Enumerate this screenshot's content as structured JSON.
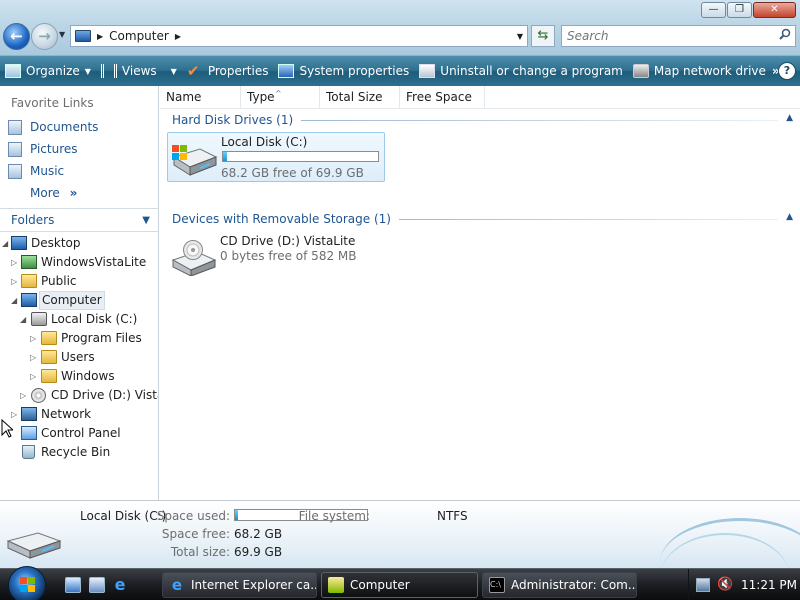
{
  "window": {
    "min_glyph": "—",
    "max_glyph": "❐",
    "close_glyph": "✕"
  },
  "nav": {
    "back_glyph": "←",
    "forward_glyph": "→"
  },
  "address": {
    "crumb": "Computer",
    "refresh_glyph": "⇆"
  },
  "search": {
    "placeholder": "Search"
  },
  "toolbar": {
    "organize": "Organize",
    "views": "Views",
    "properties": "Properties",
    "system_properties": "System properties",
    "uninstall": "Uninstall or change a program",
    "map_drive": "Map network drive",
    "more": "»",
    "help": "?"
  },
  "favorites": {
    "title": "Favorite Links",
    "items": [
      "Documents",
      "Pictures",
      "Music"
    ],
    "more": "More",
    "more_glyph": "»"
  },
  "folders": {
    "title": "Folders",
    "tree": [
      {
        "label": "Desktop"
      },
      {
        "label": "WindowsVistaLite"
      },
      {
        "label": "Public"
      },
      {
        "label": "Computer"
      },
      {
        "label": "Local Disk (C:)"
      },
      {
        "label": "Program Files"
      },
      {
        "label": "Users"
      },
      {
        "label": "Windows"
      },
      {
        "label": "CD Drive (D:) VistaLite"
      },
      {
        "label": "Network"
      },
      {
        "label": "Control Panel"
      },
      {
        "label": "Recycle Bin"
      }
    ]
  },
  "columns": [
    "Name",
    "Type",
    "Total Size",
    "Free Space"
  ],
  "groups": {
    "hard_disk": {
      "title": "Hard Disk Drives (1)",
      "items": [
        {
          "name": "Local Disk (C:)",
          "free": "68.2 GB free of 69.9 GB",
          "used_fraction": 0.024
        }
      ]
    },
    "removable": {
      "title": "Devices with Removable Storage (1)",
      "items": [
        {
          "name": "CD Drive (D:) VistaLite",
          "free": "0 bytes free of 582 MB"
        }
      ]
    }
  },
  "details": {
    "name": "Local Disk (C:)",
    "space_used_label": "Space used:",
    "space_used_fraction": 0.024,
    "space_free_label": "Space free:",
    "space_free": "68.2 GB",
    "total_size_label": "Total size:",
    "total_size": "69.9 GB",
    "file_system_label": "File system:",
    "file_system": "NTFS"
  },
  "taskbar": {
    "tasks": [
      {
        "label": "Internet Explorer ca..."
      },
      {
        "label": "Computer"
      },
      {
        "label": "Administrator: Com..."
      }
    ],
    "clock": "11:21 PM"
  },
  "colors": {
    "link": "#1f5590",
    "toolbar": "#2f6f8e",
    "selection": "#ddeefa"
  }
}
